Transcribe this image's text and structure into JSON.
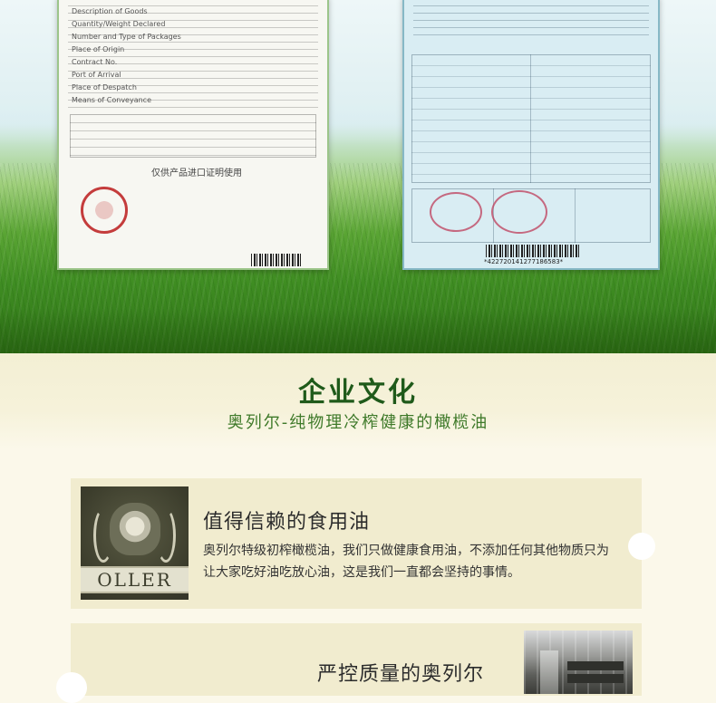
{
  "certificates": {
    "left": {
      "lines": [
        "Description of Goods",
        "Quantity/Weight Declared",
        "Number and Type of Packages",
        "Place of Origin",
        "Contract No.",
        "Port of Arrival",
        "Place of Despatch",
        "Means of Conveyance"
      ],
      "stamp_note": "仅供产品进口证明使用"
    },
    "right": {
      "barcode_number": "*422720141277186583*"
    }
  },
  "culture": {
    "title": "企业文化",
    "subtitle": "奥列尔-纯物理冷榨健康的橄榄油"
  },
  "cards": [
    {
      "logo_text": "OLLER",
      "title": "值得信赖的食用油",
      "description": "奥列尔特级初榨橄榄油，我们只做健康食用油，不添加任何其他物质只为让大家吃好油吃放心油，这是我们一直都会坚持的事情。"
    },
    {
      "title": "严控质量的奥列尔"
    }
  ],
  "colors": {
    "heading_green": "#1f5a1a",
    "subtitle_green": "#3f7a2a",
    "card_bg": "#f1eccf",
    "page_bg": "#fbf8ea"
  }
}
